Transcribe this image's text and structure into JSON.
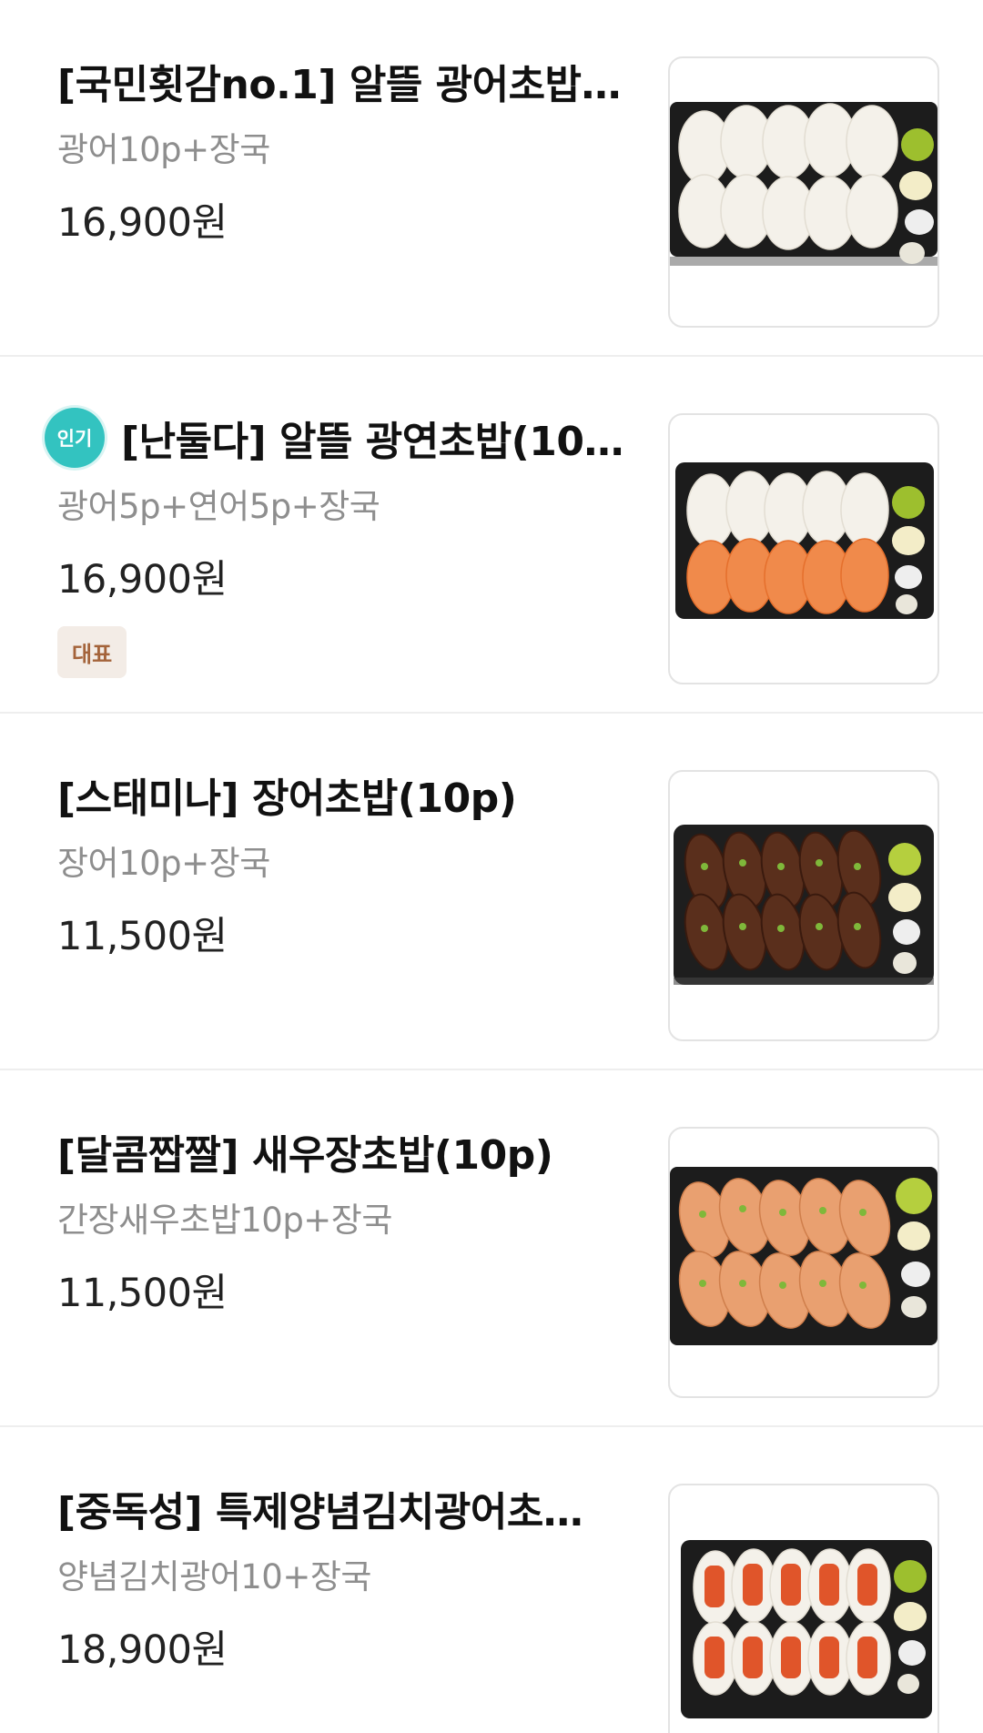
{
  "menu": {
    "items": [
      {
        "title": "[국민횟감no.1] 알뜰 광어초밥…",
        "description": "광어10p+장국",
        "price": "16,900원",
        "image_icon": "flatfish-sushi-image"
      },
      {
        "popular_badge": "인기",
        "title": "[난둘다] 알뜰 광연초밥(10…",
        "description": "광어5p+연어5p+장국",
        "price": "16,900원",
        "tag": "대표",
        "image_icon": "flatfish-salmon-sushi-image"
      },
      {
        "title": "[스태미나] 장어초밥(10p)",
        "description": "장어10p+장국",
        "price": "11,500원",
        "image_icon": "eel-sushi-image"
      },
      {
        "title": "[달콤짭짤] 새우장초밥(10p)",
        "description": "간장새우초밥10p+장국",
        "price": "11,500원",
        "image_icon": "shrimp-sushi-image"
      },
      {
        "title": "[중독성] 특제양념김치광어초…",
        "description": "양념김치광어10+장국",
        "price": "18,900원",
        "image_icon": "kimchi-flatfish-sushi-image"
      }
    ]
  },
  "colors": {
    "popular_badge": "#33c3c0",
    "tag_bg": "#f3ece6",
    "tag_text": "#a4633a",
    "description": "#8e8e8e",
    "divider": "#eeeeee",
    "flatfish": "#f4f1ea",
    "salmon": "#f08a4b",
    "eel": "#5a2f1c",
    "shrimp": "#e9a070",
    "kimchi": "#e0552a",
    "tray": "#1c1c1c",
    "wasabi": "#9dbf2e"
  }
}
